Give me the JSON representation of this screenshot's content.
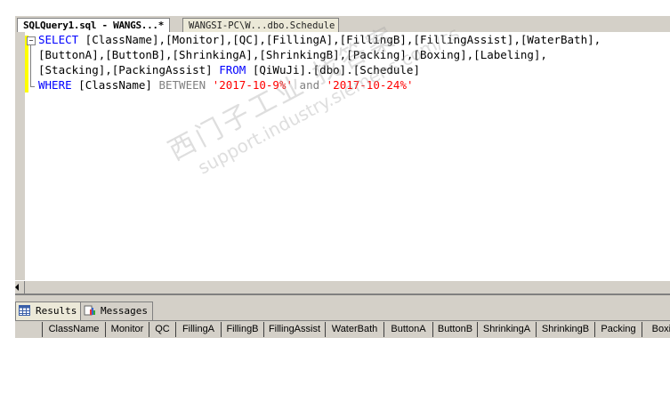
{
  "tabs": [
    {
      "label": "SQLQuery1.sql - WANGS...*",
      "active": true
    },
    {
      "label": "WANGSI-PC\\W...dbo.Schedule",
      "active": false
    }
  ],
  "editor": {
    "lines": [
      [
        {
          "t": "SELECT",
          "c": "kw"
        },
        {
          "t": " [ClassName],[Monitor],[QC],[FillingA],[FillingB],[FillingAssist],[WaterBath],",
          "c": ""
        }
      ],
      [
        {
          "t": "[ButtonA],[ButtonB],[ShrinkingA],[ShrinkingB],[Packing],[Boxing],[Labeling],",
          "c": ""
        }
      ],
      [
        {
          "t": "[Stacking],[PackingAssist] ",
          "c": ""
        },
        {
          "t": "FROM",
          "c": "kw"
        },
        {
          "t": " [QiWuJi].[dbo].[Schedule]",
          "c": ""
        }
      ],
      [
        {
          "t": "WHERE",
          "c": "kw"
        },
        {
          "t": " [ClassName] ",
          "c": ""
        },
        {
          "t": "BETWEEN",
          "c": "gr"
        },
        {
          "t": " ",
          "c": ""
        },
        {
          "t": "'2017-10-9%'",
          "c": "st"
        },
        {
          "t": " ",
          "c": ""
        },
        {
          "t": "and",
          "c": "gr"
        },
        {
          "t": " ",
          "c": ""
        },
        {
          "t": "'2017-10-24%'",
          "c": "st"
        }
      ]
    ]
  },
  "results_tabs": {
    "results": "Results",
    "messages": "Messages"
  },
  "grid_columns": [
    "ClassName",
    "Monitor",
    "QC",
    "FillingA",
    "FillingB",
    "FillingAssist",
    "WaterBath",
    "ButtonA",
    "ButtonB",
    "ShrinkingA",
    "ShrinkingB",
    "Packing",
    "Boxing"
  ],
  "watermark": {
    "line1": "西门子工业  找答案",
    "line2": "support.industry.siemens.com/cs"
  }
}
